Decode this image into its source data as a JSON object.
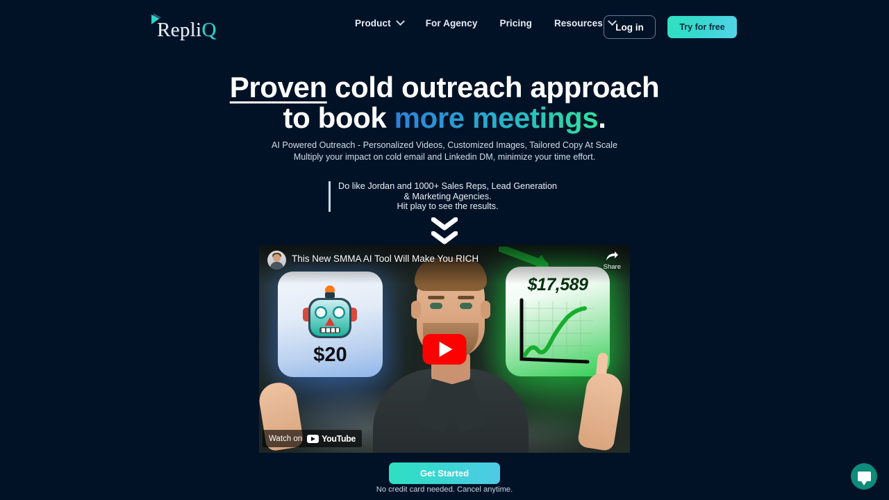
{
  "brand": {
    "name_part1": "Repli",
    "name_part2": "Q",
    "logo_icon": "play-triangle-icon",
    "accent_teal": "#2ad8c8",
    "background": "#011227"
  },
  "nav": {
    "items": [
      {
        "label": "Product",
        "has_dropdown": true
      },
      {
        "label": "For Agency",
        "has_dropdown": false
      },
      {
        "label": "Pricing",
        "has_dropdown": false
      },
      {
        "label": "Resources",
        "has_dropdown": true
      }
    ],
    "login_label": "Log in",
    "try_label": "Try for free"
  },
  "hero": {
    "headline_underlined": "Proven",
    "headline_rest": " cold outreach approach",
    "headline_line2_white": "to book ",
    "headline_line2_gradient": "more meetings",
    "headline_period": ".",
    "sub_line1": "AI Powered Outreach - Personalized Videos, Customized Images, Tailored Copy At Scale",
    "sub_line2": "Multiply your impact on cold email and Linkedin DM, minimize your time effort.",
    "quote_line1": "Do like Jordan and 1000+ Sales Reps, Lead Generation",
    "quote_line2": "& Marketing Agencies.",
    "quote_line3": "Hit play to see the results.",
    "scroll_icon": "double-chevron-down-icon",
    "gradient_start": "#2f7fd6",
    "gradient_mid": "#29b8c4",
    "gradient_end": "#31e39b"
  },
  "video": {
    "title": "This New SMMA AI Tool Will Make You RICH",
    "share_label": "Share",
    "share_icon": "share-arrow-icon",
    "play_icon": "youtube-play-icon",
    "watch_on_label": "Watch on",
    "youtube_wordmark": "YouTube",
    "avatar": "channel-avatar",
    "thumbnail": {
      "left_card_amount": "$20",
      "left_card_icon": "robot-icon",
      "right_card_amount": "$17,589",
      "right_card_icon": "rising-chart-icon",
      "arrow_icon": "green-arrow-icon"
    }
  },
  "cta": {
    "button_label": "Get Started",
    "note": "No credit card needed. Cancel anytime."
  },
  "chat": {
    "icon": "chat-bubble-icon",
    "color": "#0e8b7a"
  }
}
